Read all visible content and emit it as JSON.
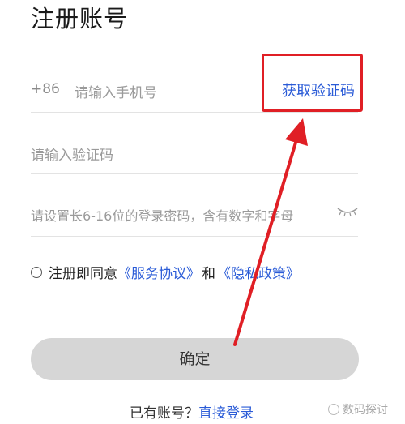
{
  "page_title": "注册账号",
  "phone": {
    "prefix": "+86",
    "placeholder": "请输入手机号",
    "get_code_label": "获取验证码"
  },
  "code": {
    "placeholder": "请输入验证码"
  },
  "password": {
    "placeholder": "请设置长6-16位的登录密码，含有数字和字母"
  },
  "agreement": {
    "prefix": "注册即同意",
    "service_link": "《服务协议》",
    "and": "和",
    "privacy_link": "《隐私政策》"
  },
  "confirm_label": "确定",
  "login": {
    "prompt": "已有账号？",
    "link": "直接登录"
  },
  "watermark": "数码探讨",
  "annotation_color": "#e01f25",
  "link_color": "#2a5bd7"
}
